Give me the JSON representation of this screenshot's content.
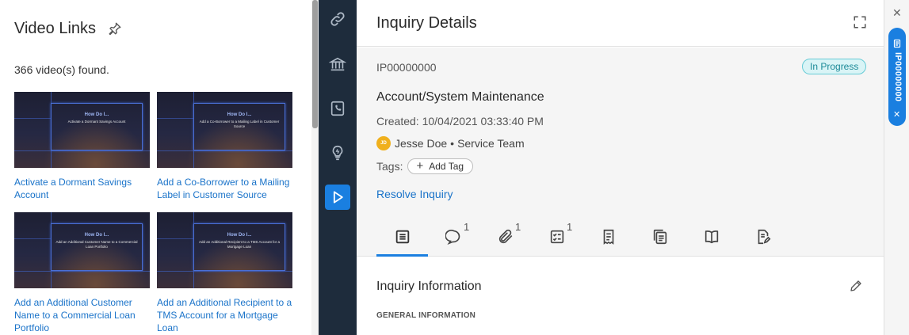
{
  "video_panel": {
    "title": "Video Links",
    "count_text": "366 video(s) found.",
    "videos": [
      {
        "thumb_title": "How Do I...",
        "thumb_subtitle": "Activate a Dormant Savings Account",
        "caption": "Activate a Dormant Savings Account"
      },
      {
        "thumb_title": "How Do I...",
        "thumb_subtitle": "Add a Co-Borrower to a Mailing Label in Customer Source",
        "caption": "Add a Co-Borrower to a Mailing Label in Customer Source"
      },
      {
        "thumb_title": "How Do I...",
        "thumb_subtitle": "Add an Additional Customer Name to a Commercial Loan Portfolio",
        "caption": "Add an Additional Customer Name to a Commercial Loan Portfolio"
      },
      {
        "thumb_title": "How Do I...",
        "thumb_subtitle": "Add an Additional Recipient to a TMS Account for a Mortgage Loan",
        "caption": "Add an Additional Recipient to a TMS Account for a Mortgage Loan"
      }
    ]
  },
  "nav": {
    "items": [
      "link-icon",
      "bank-icon",
      "phone-book-icon",
      "lightbulb-icon",
      "play-icon"
    ],
    "active": "play-icon",
    "active_color": "#1a7fe0",
    "bg_color": "#1e2c3c"
  },
  "inquiry": {
    "title": "Inquiry Details",
    "id": "IP00000000",
    "status": "In Progress",
    "subject": "Account/System Maintenance",
    "created": "Created: 10/04/2021 03:33:40 PM",
    "user": {
      "initials": "JD",
      "name": "Jesse Doe",
      "separator": "•",
      "team": "Service Team"
    },
    "tags_label": "Tags:",
    "add_tag_label": "Add Tag",
    "resolve_label": "Resolve Inquiry",
    "tabs": [
      {
        "icon": "details-icon",
        "badge": ""
      },
      {
        "icon": "comment-icon",
        "badge": "1"
      },
      {
        "icon": "attachment-icon",
        "badge": "1"
      },
      {
        "icon": "checklist-icon",
        "badge": "1"
      },
      {
        "icon": "receipt-icon",
        "badge": ""
      },
      {
        "icon": "copy-document-icon",
        "badge": ""
      },
      {
        "icon": "book-icon",
        "badge": ""
      },
      {
        "icon": "document-edit-icon",
        "badge": ""
      }
    ],
    "section_title": "Inquiry Information",
    "general_label": "GENERAL INFORMATION"
  },
  "strip": {
    "close_label": "✕",
    "pill_text": "IP00000000",
    "pill_close": "✕",
    "pill_color": "#1a7fe0"
  }
}
